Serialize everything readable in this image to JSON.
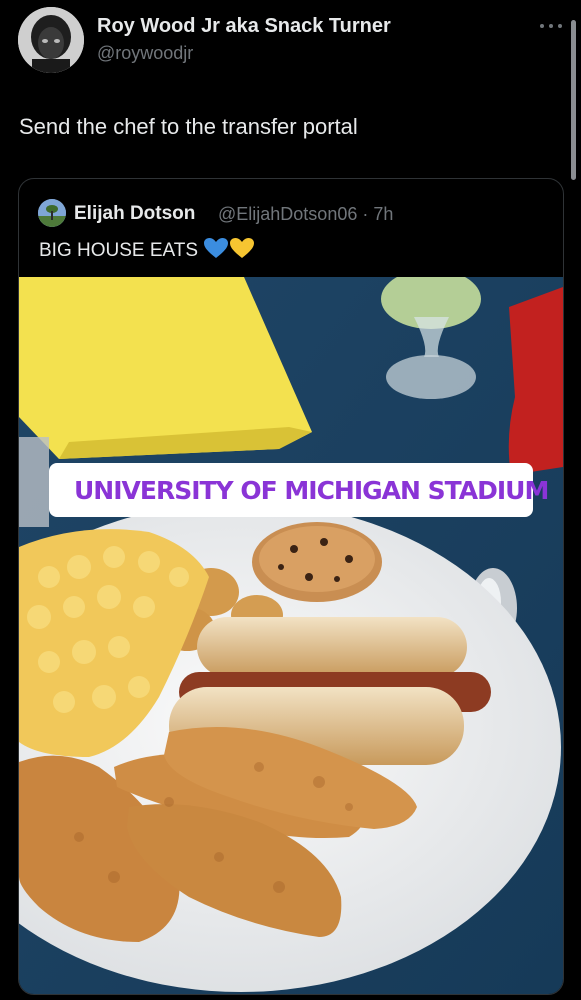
{
  "tweet": {
    "author_name": "Roy Wood Jr aka Snack Turner",
    "author_handle": "@roywoodjr",
    "more_icon": "more-horizontal-icon",
    "text": "Send the chef to the transfer portal"
  },
  "quoted": {
    "author_name": "Elijah Dotson",
    "author_handle": "@ElijahDotson06 · 7h",
    "text": "BIG HOUSE EATS",
    "emoji": [
      "blue-heart",
      "yellow-heart"
    ],
    "photo": {
      "location_sticker": "UNIVERSITY OF MICHIGAN STADIUM",
      "sticker_color": "#8a34d6"
    }
  },
  "colors": {
    "background": "#000000",
    "primary_text": "#e7e9ea",
    "secondary_text": "#71767b",
    "border": "#2f3336"
  }
}
